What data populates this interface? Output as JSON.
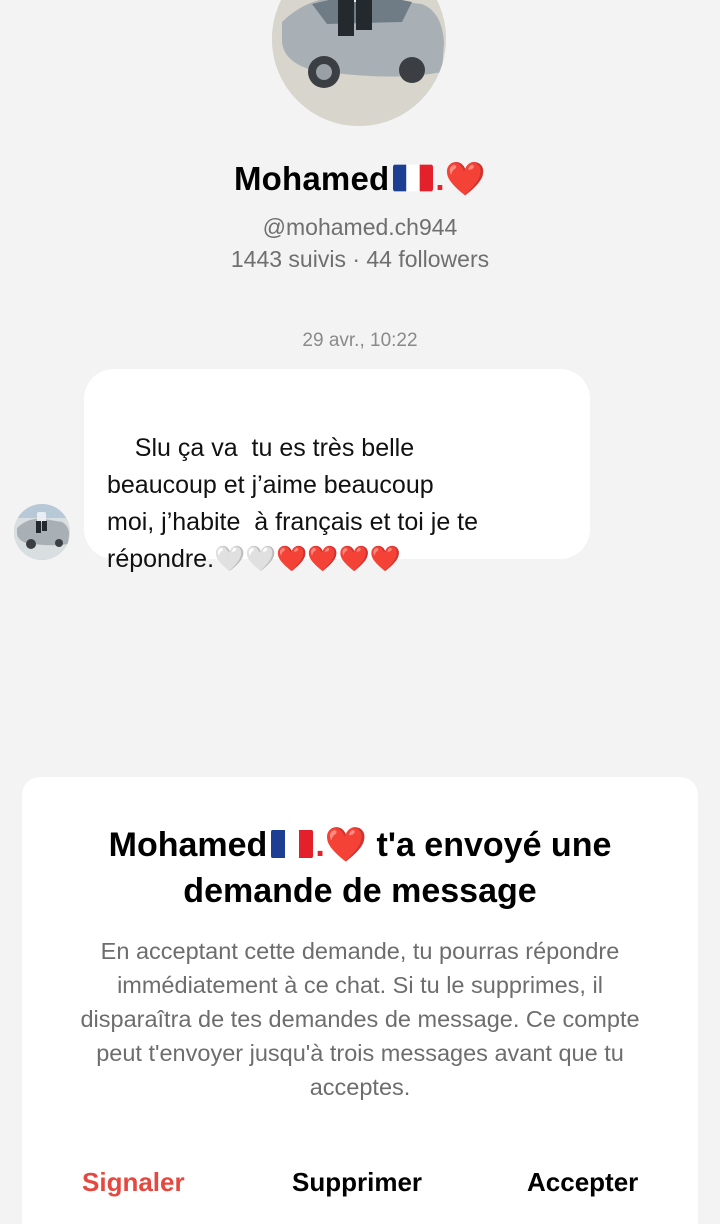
{
  "profile": {
    "name": "Mohamed",
    "name_suffix": ".❤️",
    "handle": "@mohamed.ch944",
    "stats": "1443 suivis · 44 followers"
  },
  "chat": {
    "timestamp": "29 avr., 10:22",
    "message": "Slu ça va  tu es très belle\nbeaucoup et j’aime beaucoup\nmoi, j’habite  à français et toi je te\nrépondre.🤍🤍❤️❤️❤️❤️"
  },
  "sheet": {
    "title_name": "Mohamed",
    "title_suffix": ".❤️",
    "title_rest": " t'a envoyé une",
    "title_line2": "demande de message",
    "body": "En acceptant cette demande, tu pourras répondre immédiatement à ce chat. Si tu le supprimes, il disparaîtra de tes demandes de message. Ce compte peut t'envoyer jusqu'à trois messages avant que tu acceptes.",
    "actions": {
      "report": "Signaler",
      "delete": "Supprimer",
      "accept": "Accepter"
    }
  },
  "colors": {
    "background": "#f3f3f3",
    "report": "#e5483f",
    "muted_text": "#6f6f6f"
  },
  "icons": {
    "flag": "france-flag-icon",
    "heart": "red-heart-icon"
  }
}
